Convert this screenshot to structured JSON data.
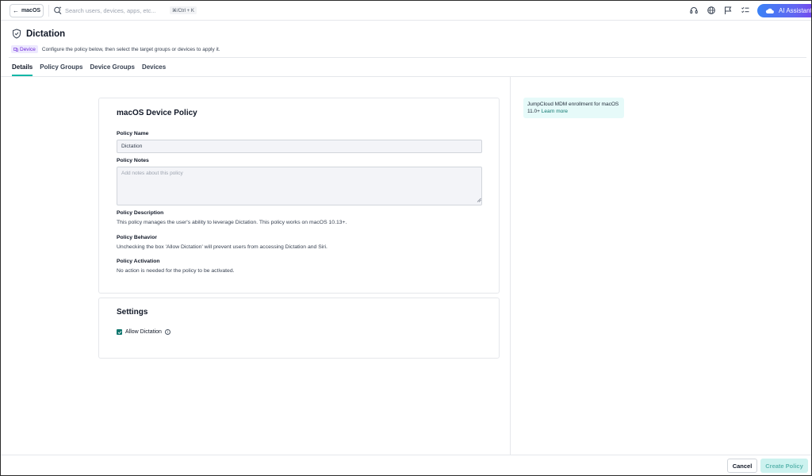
{
  "topbar": {
    "back_label": "macOS",
    "search_placeholder": "Search users, devices, apps, etc...",
    "shortcut": "⌘/Ctrl + K",
    "ai_label": "AI Assistant"
  },
  "header": {
    "title": "Dictation",
    "badge": "Device",
    "subtitle": "Configure the policy below, then select the target groups or devices to apply it."
  },
  "tabs": [
    {
      "label": "Details",
      "active": true
    },
    {
      "label": "Policy Groups",
      "active": false
    },
    {
      "label": "Device Groups",
      "active": false
    },
    {
      "label": "Devices",
      "active": false
    }
  ],
  "policy_card": {
    "title": "macOS Device Policy",
    "name_label": "Policy Name",
    "name_value": "Dictation",
    "notes_label": "Policy Notes",
    "notes_placeholder": "Add notes about this policy",
    "description_label": "Policy Description",
    "description_text": "This policy manages the user's ability to leverage Dictation. This policy works on macOS 10.13+.",
    "behavior_label": "Policy Behavior",
    "behavior_text": "Unchecking the box 'Allow Dictation' will prevent users from accessing Dictation and Siri.",
    "activation_label": "Policy Activation",
    "activation_text": "No action is needed for the policy to be activated."
  },
  "settings_card": {
    "title": "Settings",
    "allow_dictation_label": "Allow Dictation",
    "allow_dictation_checked": true
  },
  "info_panel": {
    "text": "JumpCloud MDM enrollment for macOS 11.0+",
    "link": "Learn more"
  },
  "footer": {
    "cancel_label": "Cancel",
    "create_label": "Create Policy"
  },
  "colors": {
    "accent": "#14b8a6",
    "checkbox": "#0f766e",
    "badge_bg": "#ede9fe",
    "badge_text": "#6d28d9",
    "info_bg": "#e6faf9",
    "create_bg": "#ccf2ef"
  }
}
